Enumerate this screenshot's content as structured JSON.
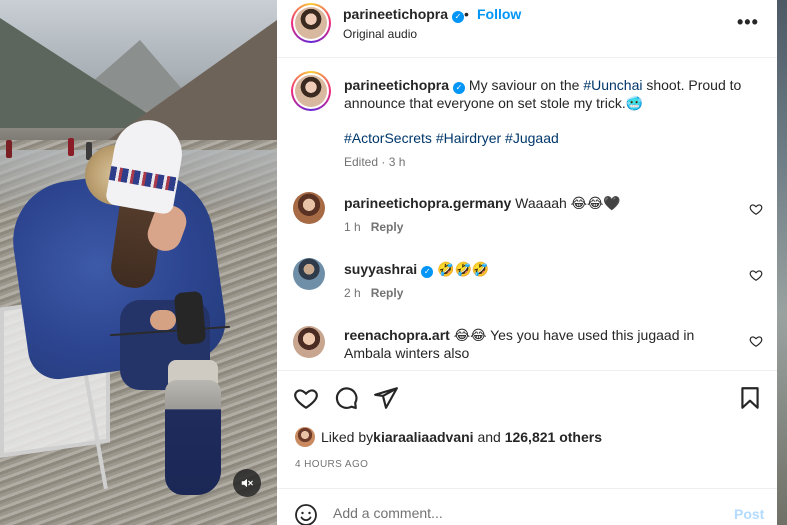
{
  "post": {
    "author": "parineetichopra",
    "follow_label": "Follow",
    "separator": "•",
    "audio_label": "Original audio",
    "more_icon": "more-horizontal-icon"
  },
  "caption": {
    "username": "parineetichopra",
    "text_before": "My saviour on the ",
    "hashtag_inline": "#Uunchai",
    "text_after": " shoot. Proud to announce that everyone on set stole my trick.",
    "emoji": "🥶",
    "hashtags": "#ActorSecrets #Hairdryer #Jugaad",
    "edited": "Edited · 3 h"
  },
  "comments": [
    {
      "username": "parineetichopra.germany",
      "text": "Waaaah 😂😂🖤",
      "time": "1 h",
      "reply_label": "Reply"
    },
    {
      "username": "suyyashrai",
      "text": "🤣🤣🤣",
      "time": "2 h",
      "reply_label": "Reply"
    },
    {
      "username": "reenachopra.art",
      "text": "😂😂 Yes you have used this jugaad in Ambala winters also"
    }
  ],
  "actions": {
    "liked_prefix": "Liked by ",
    "liked_user": "kiaraaliaadvani",
    "liked_middle": " and ",
    "liked_count": "126,821 others",
    "timestamp": "4 HOURS AGO"
  },
  "comment_box": {
    "placeholder": "Add a comment...",
    "post_label": "Post"
  },
  "colors": {
    "link_blue": "#0095f6",
    "hashtag_navy": "#00376b",
    "muted_gray": "#737373"
  }
}
